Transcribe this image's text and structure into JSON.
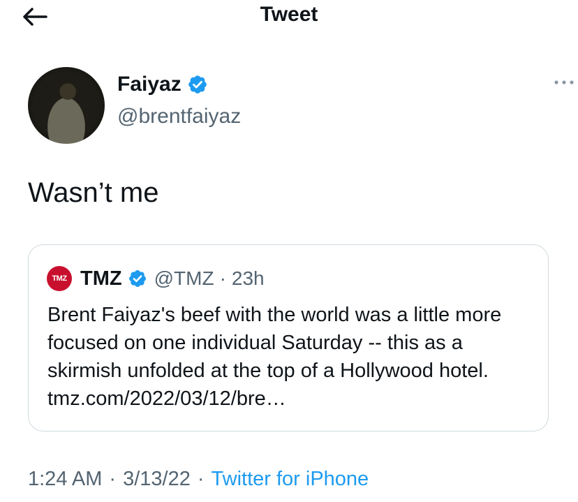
{
  "header": {
    "title": "Tweet"
  },
  "author": {
    "name": "Faiyaz",
    "handle": "@brentfaiyaz"
  },
  "tweet": {
    "text": "Wasn’t me"
  },
  "quote": {
    "logo_text": "TMZ",
    "name": "TMZ",
    "handle": "@TMZ",
    "separator": "·",
    "time": "23h",
    "text": "Brent Faiyaz's beef with the world was a little more focused on one individual Saturday -- this as a skirmish unfolded at the top of a Hollywood hotel. tmz.com/2022/03/12/bre…"
  },
  "meta": {
    "time": "1:24 AM",
    "separator": "·",
    "date": "3/13/22",
    "source": "Twitter for iPhone"
  },
  "icons": {
    "back": "arrow-left-icon",
    "verified": "verified-badge-icon",
    "more": "more-horizontal-icon"
  },
  "colors": {
    "link": "#1d9bf0",
    "verified": "#1d9bf0",
    "secondary_text": "#536471",
    "tmz_red": "#c8102e"
  }
}
